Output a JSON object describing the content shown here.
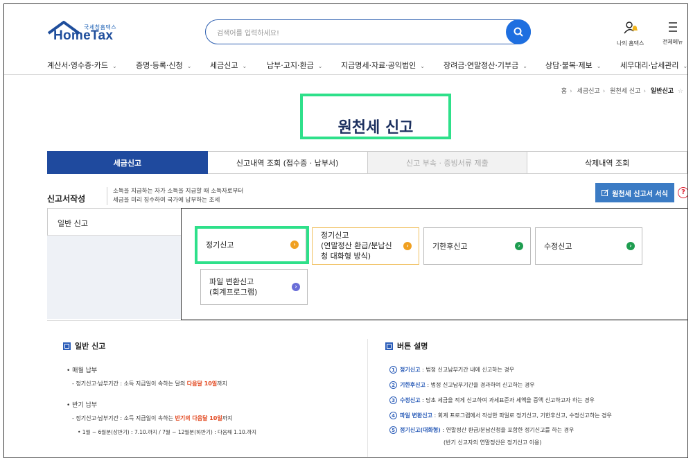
{
  "header": {
    "logo_sub": "국세청홈택스",
    "logo_name": "HomeTax",
    "search_placeholder": "검색어를 입력하세요!",
    "my_hometax_label": "나의 홈택스",
    "all_menu_label": "전체메뉴"
  },
  "gnb": [
    "계산서·영수증·카드",
    "증명·등록·신청",
    "세금신고",
    "납부·고지·환급",
    "지급명세·자료·공익법인",
    "장려금·연말정산·기부금",
    "상담·불복·제보",
    "세무대리·납세관리"
  ],
  "breadcrumb": [
    "홈",
    "세금신고",
    "원천세 신고",
    "일반신고"
  ],
  "page_title": "원천세 신고",
  "tabs": [
    {
      "label": "세금신고"
    },
    {
      "label": "신고내역 조회 (접수증 · 납부서)"
    },
    {
      "label": "신고 부속 · 증빙서류 제출"
    },
    {
      "label": "삭제내역 조회"
    }
  ],
  "section": {
    "title": "신고서작성",
    "desc_line1": "소득을 지급하는 자가 소득을 지급할 때 소득자로부터",
    "desc_line2": "세금을 미리 징수하여 국가에 납부하는 조세",
    "form_button": "원천세 신고서 서식",
    "help": "?"
  },
  "panel": {
    "category": "일반 신고",
    "options": {
      "regular": "정기신고",
      "regular_dialog_1": "정기신고",
      "regular_dialog_2": "(연말정산 환급/분납신",
      "regular_dialog_3": "청 대화형 방식)",
      "late": "기한후신고",
      "amend": "수정신고",
      "file_1": "파일 변환신고",
      "file_2": "(회계프로그램)"
    }
  },
  "info_left": {
    "title": "일반 신고",
    "monthly_head": "• 매월 납부",
    "monthly_pre": "- 정기신고·납부기간 : 소득 지급일이 속하는 달의 ",
    "monthly_em": "다음달 10일",
    "monthly_post": "까지",
    "half_head": "• 반기 납부",
    "half_pre": "- 정기신고·납부기간 : 소득 지급일이 속하는 ",
    "half_em": "반기의 다음달 10일",
    "half_post": "까지",
    "half_detail": "• 1월 ~ 6월분(상반기) : 7.10.까지 / 7월 ~ 12월분(하반기) : 다음해 1.10.까지"
  },
  "info_right": {
    "title": "버튼 설명",
    "items": [
      {
        "n": "1",
        "name": "정기신고",
        "desc": " : 법정 신고납부기간 내에 신고하는 경우"
      },
      {
        "n": "2",
        "name": "기한후신고",
        "desc": " : 법정 신고납부기간을 경과하여 신고하는 경우"
      },
      {
        "n": "3",
        "name": "수정신고",
        "desc": " : 당초 세금을 적게 신고하여 과세표준과 세액을 증액 신고하고자 하는 경우"
      },
      {
        "n": "4",
        "name": "파일 변환신고",
        "desc": " : 회계 프로그램에서 작성한 파일로 정기신고, 기한후신고, 수정신고하는 경우"
      },
      {
        "n": "5",
        "name": "정기신고(대화형)",
        "desc": " : 연말정산 환급/분납신청을 포함한 정기신고를 하는 경우"
      }
    ],
    "note": "(반기 신고자의 연말정산은 정기신고 이용)"
  },
  "colors": {
    "brand": "#1f4a9e",
    "highlight": "#2ee08a",
    "accent_red": "#e2451c"
  }
}
